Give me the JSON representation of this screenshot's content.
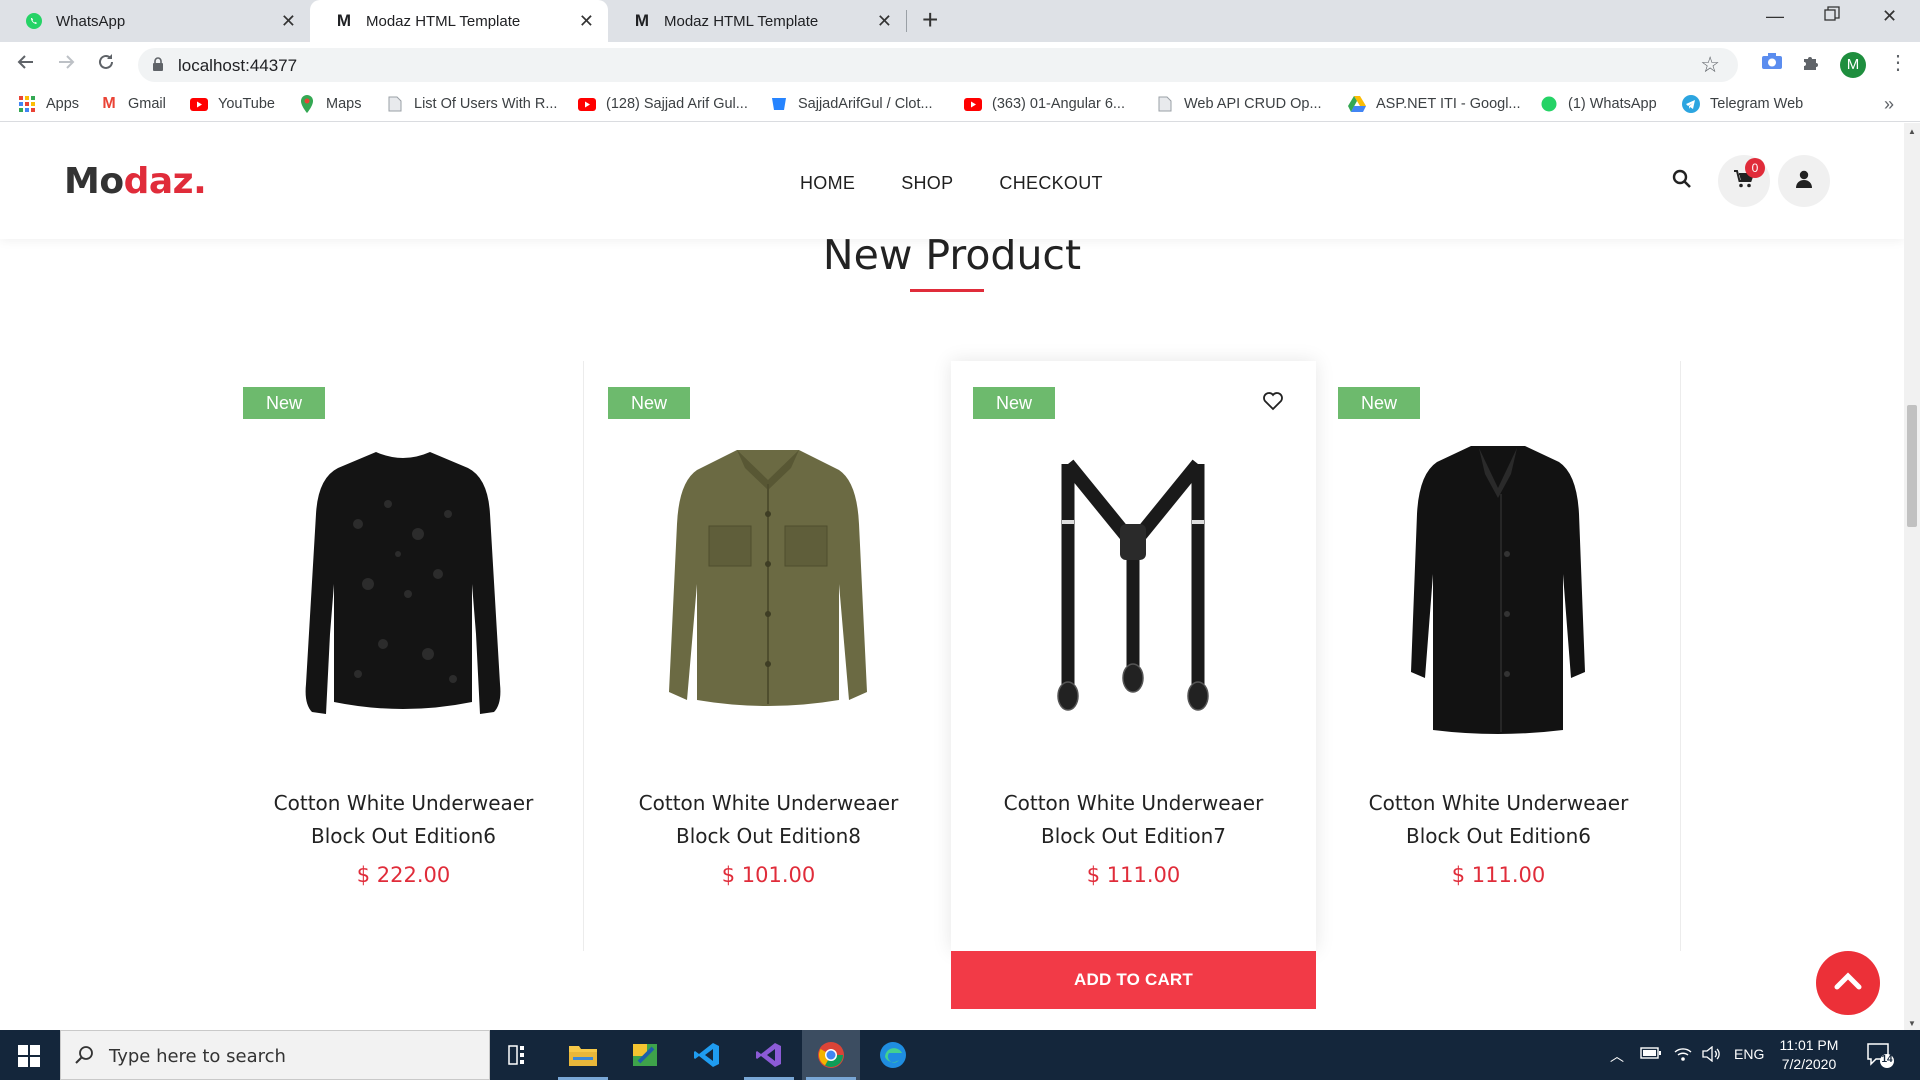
{
  "browser": {
    "tabs": [
      {
        "title": "WhatsApp"
      },
      {
        "title": "Modaz HTML Template"
      },
      {
        "title": "Modaz HTML Template"
      }
    ],
    "url": "localhost:44377",
    "profile_initial": "M",
    "bookmarks": [
      {
        "label": "Apps",
        "icon": "apps-grid-icon"
      },
      {
        "label": "Gmail",
        "icon": "gmail-icon"
      },
      {
        "label": "YouTube",
        "icon": "youtube-icon"
      },
      {
        "label": "Maps",
        "icon": "maps-icon"
      },
      {
        "label": "List Of Users With R...",
        "icon": "page-icon"
      },
      {
        "label": "(128) Sajjad Arif Gul...",
        "icon": "youtube-icon"
      },
      {
        "label": "SajjadArifGul / Clot...",
        "icon": "bitbucket-icon"
      },
      {
        "label": "(363) 01-Angular 6...",
        "icon": "youtube-icon"
      },
      {
        "label": "Web API CRUD Op...",
        "icon": "page-icon"
      },
      {
        "label": "ASP.NET ITI - Googl...",
        "icon": "drive-icon"
      },
      {
        "label": "(1) WhatsApp",
        "icon": "whatsapp-icon"
      },
      {
        "label": "Telegram Web",
        "icon": "telegram-icon"
      }
    ]
  },
  "site": {
    "logo_part1": "Mo",
    "logo_part2": "daz.",
    "nav": [
      "HOME",
      "SHOP",
      "CHECKOUT"
    ],
    "cart_count": "0",
    "section_title": "New Product",
    "badge_label": "New",
    "add_to_cart": "ADD TO CART",
    "products": [
      {
        "name_line1": "Cotton White Underweaer",
        "name_line2": "Block Out Edition6",
        "price": "$ 222.00",
        "image": "lace-blouse"
      },
      {
        "name_line1": "Cotton White Underweaer",
        "name_line2": "Block Out Edition8",
        "price": "$ 101.00",
        "image": "khaki-jacket"
      },
      {
        "name_line1": "Cotton White Underweaer",
        "name_line2": "Block Out Edition7",
        "price": "$ 111.00",
        "image": "suspenders"
      },
      {
        "name_line1": "Cotton White Underweaer",
        "name_line2": "Block Out Edition6",
        "price": "$ 111.00",
        "image": "black-coat"
      }
    ]
  },
  "taskbar": {
    "search_placeholder": "Type here to search",
    "language": "ENG",
    "time": "11:01 PM",
    "date": "7/2/2020",
    "notification_count": "14"
  },
  "colors": {
    "accent": "#e02c3a",
    "badge_green": "#6dba6d",
    "taskbar": "#14263b"
  }
}
